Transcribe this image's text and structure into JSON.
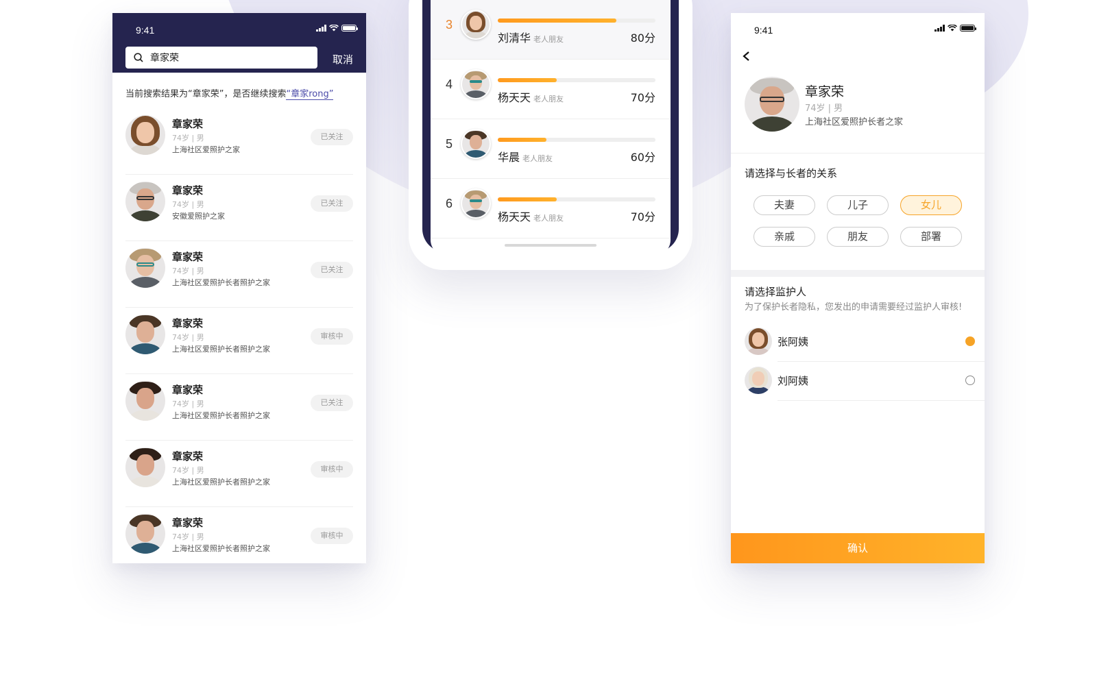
{
  "status": {
    "time": "9:41"
  },
  "search": {
    "query": "章家荣",
    "cancel_label": "取消",
    "hint_prefix": "当前搜索结果为“章家荣”，是否继续搜索",
    "hint_link": "“章家rong”"
  },
  "results": [
    {
      "name": "章家荣",
      "meta": "74岁 | 男",
      "org": "上海社区爱照护之家",
      "tag": "已关注"
    },
    {
      "name": "章家荣",
      "meta": "74岁 | 男",
      "org": "安徽爱照护之家",
      "tag": "已关注"
    },
    {
      "name": "章家荣",
      "meta": "74岁 | 男",
      "org": "上海社区爱照护长者照护之家",
      "tag": "已关注"
    },
    {
      "name": "章家荣",
      "meta": "74岁 | 男",
      "org": "上海社区爱照护长者照护之家",
      "tag": "审核中"
    },
    {
      "name": "章家荣",
      "meta": "74岁 | 男",
      "org": "上海社区爱照护长者照护之家",
      "tag": "已关注"
    },
    {
      "name": "章家荣",
      "meta": "74岁 | 男",
      "org": "上海社区爱照护长者照护之家",
      "tag": "审核中"
    },
    {
      "name": "章家荣",
      "meta": "74岁 | 男",
      "org": "上海社区爱照护长者照护之家",
      "tag": "审核中"
    }
  ],
  "ranking": [
    {
      "rank": "3",
      "name": "刘清华",
      "relation": "老人朋友",
      "score": "80分",
      "progress": 0.75
    },
    {
      "rank": "4",
      "name": "杨天天",
      "relation": "老人朋友",
      "score": "70分",
      "progress": 0.375
    },
    {
      "rank": "5",
      "name": "华晨",
      "relation": "老人朋友",
      "score": "60分",
      "progress": 0.31
    },
    {
      "rank": "6",
      "name": "杨天天",
      "relation": "老人朋友",
      "score": "70分",
      "progress": 0.375
    }
  ],
  "profile": {
    "name": "章家荣",
    "meta": "74岁 | 男",
    "org": "上海社区爱照护长者之家",
    "relation_title": "请选择与长者的关系",
    "relations": [
      {
        "label": "夫妻",
        "selected": false
      },
      {
        "label": "儿子",
        "selected": false
      },
      {
        "label": "女儿",
        "selected": true
      },
      {
        "label": "亲戚",
        "selected": false
      },
      {
        "label": "朋友",
        "selected": false
      },
      {
        "label": "部署",
        "selected": false
      }
    ],
    "guardian_title": "请选择监护人",
    "guardian_subtitle": "为了保护长者隐私，您发出的申请需要经过监护人审核!",
    "guardians": [
      {
        "name": "张阿姨",
        "selected": true
      },
      {
        "name": "刘阿姨",
        "selected": false
      }
    ],
    "confirm_label": "确认"
  },
  "colors": {
    "header_navy": "#25244f",
    "accent_orange": "#f6a326",
    "link_blue": "#4a4aa8"
  }
}
